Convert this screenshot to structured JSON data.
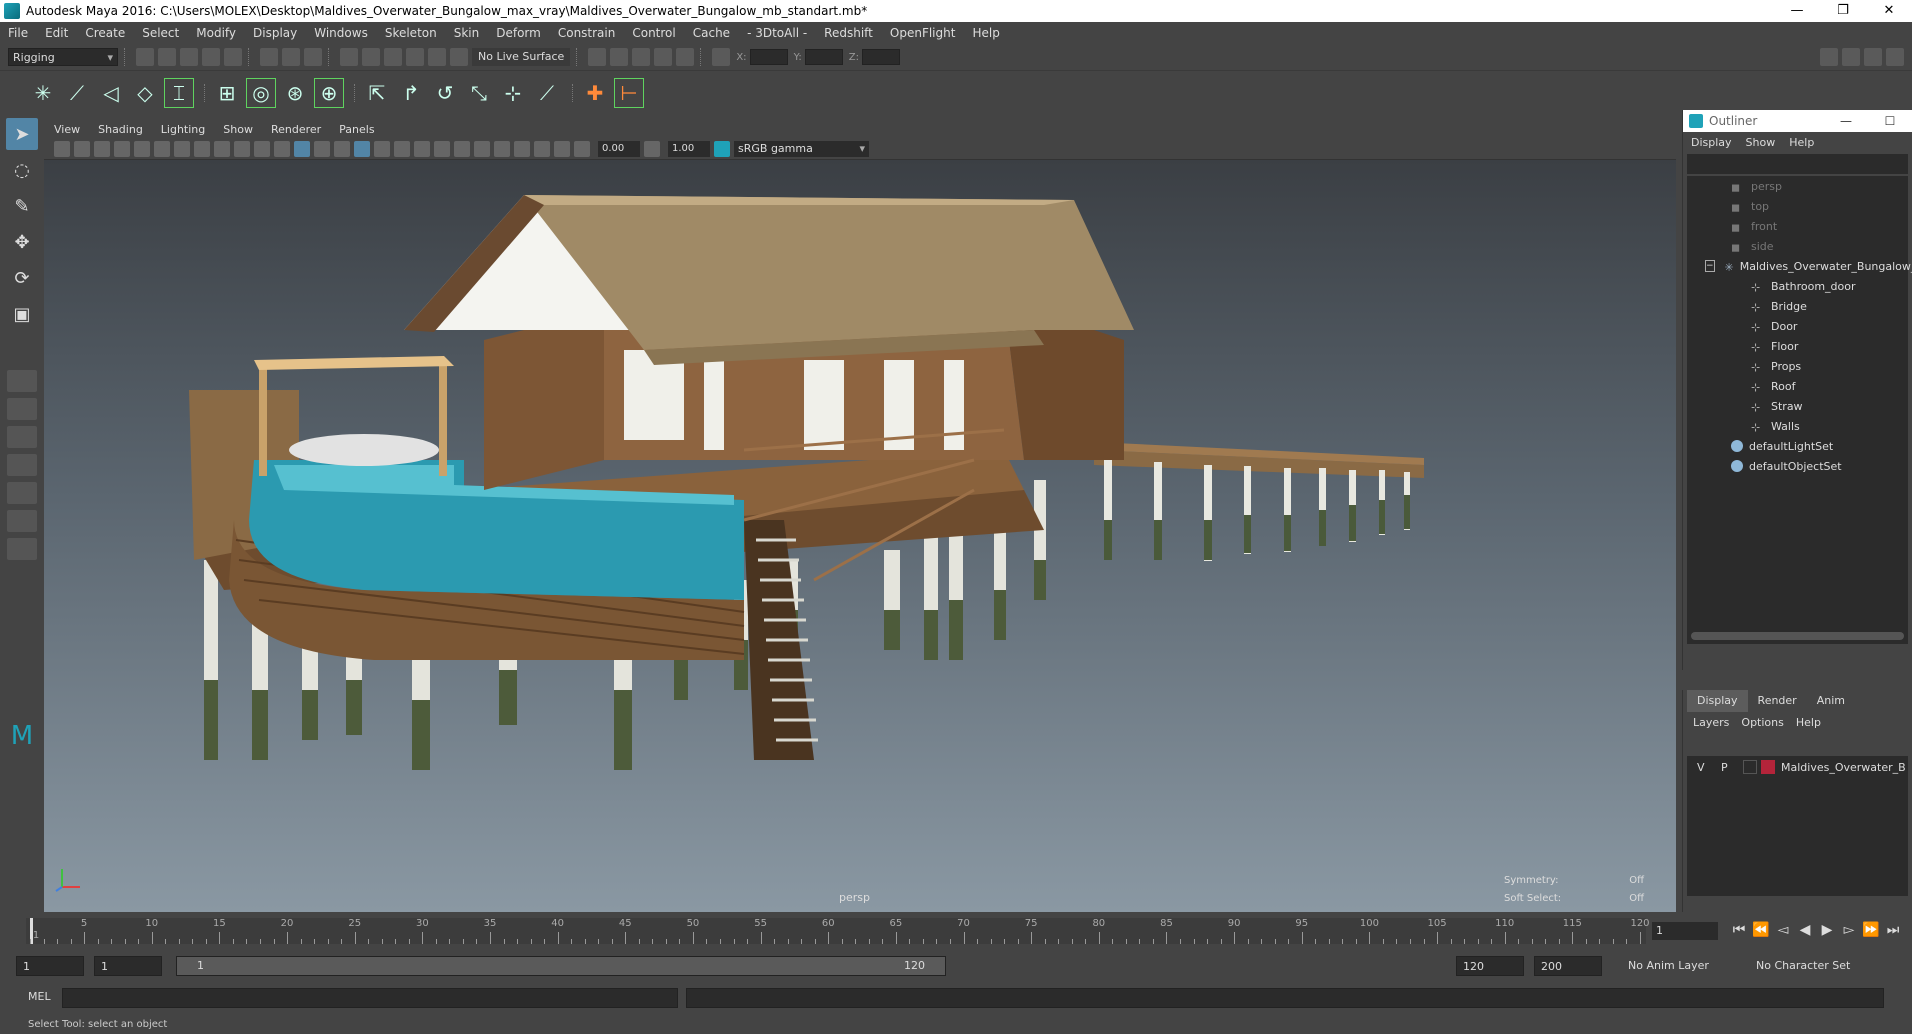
{
  "window": {
    "title": "Autodesk Maya 2016: C:\\Users\\MOLEX\\Desktop\\Maldives_Overwater_Bungalow_max_vray\\Maldives_Overwater_Bungalow_mb_standart.mb*",
    "minimize": "—",
    "restore": "❐",
    "close": "✕"
  },
  "menubar": [
    "File",
    "Edit",
    "Create",
    "Select",
    "Modify",
    "Display",
    "Windows",
    "Skeleton",
    "Skin",
    "Deform",
    "Constrain",
    "Control",
    "Cache",
    "- 3DtoAll -",
    "Redshift",
    "OpenFlight",
    "Help"
  ],
  "statusline": {
    "menuset": "Rigging",
    "live_surface": "No Live Surface",
    "x_label": "X:",
    "y_label": "Y:",
    "z_label": "Z:"
  },
  "viewport": {
    "menu": [
      "View",
      "Shading",
      "Lighting",
      "Show",
      "Renderer",
      "Panels"
    ],
    "exposure": "0.00",
    "gamma": "1.00",
    "color_space": "sRGB gamma",
    "camera": "persp",
    "symmetry_label": "Symmetry:",
    "symmetry_value": "Off",
    "soft_select_label": "Soft Select:",
    "soft_select_value": "Off"
  },
  "outliner": {
    "title": "Outliner",
    "menu": [
      "Display",
      "Show",
      "Help"
    ],
    "cameras": [
      "persp",
      "top",
      "front",
      "side"
    ],
    "group": "Maldives_Overwater_Bungalow_",
    "children": [
      "Bathroom_door",
      "Bridge",
      "Door",
      "Floor",
      "Props",
      "Roof",
      "Straw",
      "Walls"
    ],
    "sets": [
      "defaultLightSet",
      "defaultObjectSet"
    ]
  },
  "layer_editor": {
    "tabs": [
      "Display",
      "Render",
      "Anim"
    ],
    "menu": [
      "Layers",
      "Options",
      "Help"
    ],
    "layer_v": "V",
    "layer_p": "P",
    "layer_name": "Maldives_Overwater_B",
    "layer_color": "#b4243a"
  },
  "timeline": {
    "tick_labels": [
      "5",
      "10",
      "15",
      "20",
      "25",
      "30",
      "35",
      "40",
      "45",
      "50",
      "55",
      "60",
      "65",
      "70",
      "75",
      "80",
      "85",
      "90",
      "95",
      "100",
      "105",
      "110",
      "115",
      "120"
    ],
    "start": 1,
    "end": 120,
    "current_frame": "1",
    "current_frame_marker": "1"
  },
  "range": {
    "start_time": "1",
    "playback_start": "1",
    "slider_start": "1",
    "slider_end": "120",
    "playback_end": "120",
    "end_time": "200",
    "anim_layer": "No Anim Layer",
    "character_set": "No Character Set"
  },
  "cmdline": {
    "label": "MEL"
  },
  "helpline": {
    "text": "Select Tool: select an object"
  },
  "colors": {
    "ui_bg": "#444444",
    "accent": "#5285a6",
    "maya_teal": "#1fa2b8",
    "water": "#2b9ab0",
    "roof": "#a08a66",
    "wood": "#7a5634"
  }
}
